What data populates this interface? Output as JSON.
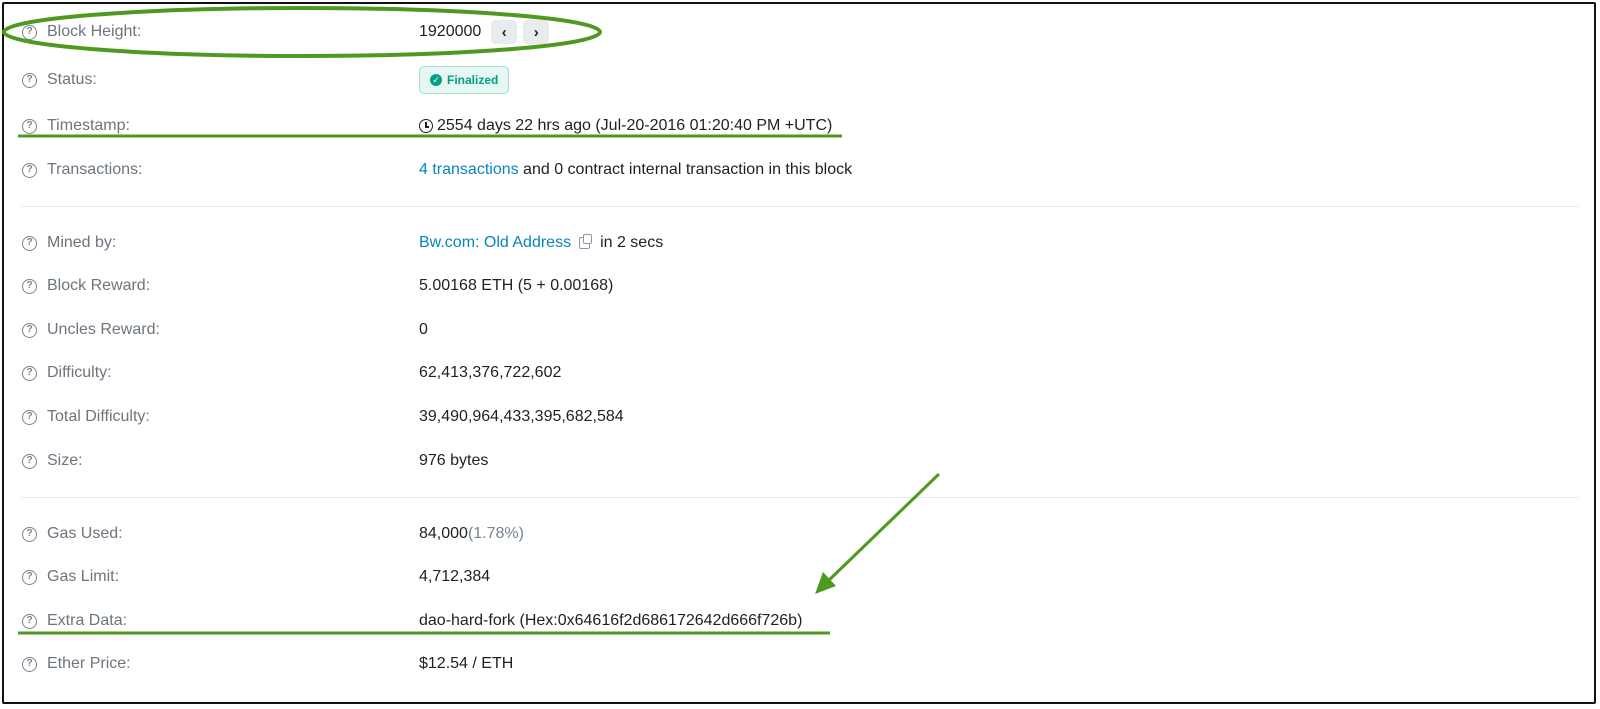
{
  "rows": {
    "block_height": {
      "label": "Block Height:",
      "value": "1920000",
      "prev": "‹",
      "next": "›"
    },
    "status": {
      "label": "Status:",
      "badge": "Finalized",
      "badge_icon": "check-circle-icon",
      "badge_color": "#00a186"
    },
    "timestamp": {
      "label": "Timestamp:",
      "value": "2554 days 22 hrs ago (Jul-20-2016 01:20:40 PM +UTC)"
    },
    "transactions": {
      "label": "Transactions:",
      "link": "4 transactions",
      "rest": " and 0 contract internal transaction in this block"
    },
    "mined_by": {
      "label": "Mined by:",
      "link": "Bw.com: Old Address",
      "rest": "in 2 secs"
    },
    "block_reward": {
      "label": "Block Reward:",
      "value": "5.00168 ETH (5 + 0.00168)"
    },
    "uncles_reward": {
      "label": "Uncles Reward:",
      "value": "0"
    },
    "difficulty": {
      "label": "Difficulty:",
      "value": "62,413,376,722,602"
    },
    "total_difficulty": {
      "label": "Total Difficulty:",
      "value": "39,490,964,433,395,682,584"
    },
    "size": {
      "label": "Size:",
      "value": "976 bytes"
    },
    "gas_used": {
      "label": "Gas Used:",
      "value": "84,000",
      "percent": "(1.78%)"
    },
    "gas_limit": {
      "label": "Gas Limit:",
      "value": "4,712,384"
    },
    "extra_data": {
      "label": "Extra Data:",
      "value": "dao-hard-fork (Hex:0x64616f2d686172642d666f726b)"
    },
    "ether_price": {
      "label": "Ether Price:",
      "value": "$12.54 / ETH"
    }
  },
  "icons": {
    "help": "question-circle-icon",
    "clock": "clock-icon",
    "copy": "copy-icon"
  },
  "colors": {
    "link": "#0784c3",
    "annotation": "#4e9a1f",
    "muted": "#77838f"
  }
}
